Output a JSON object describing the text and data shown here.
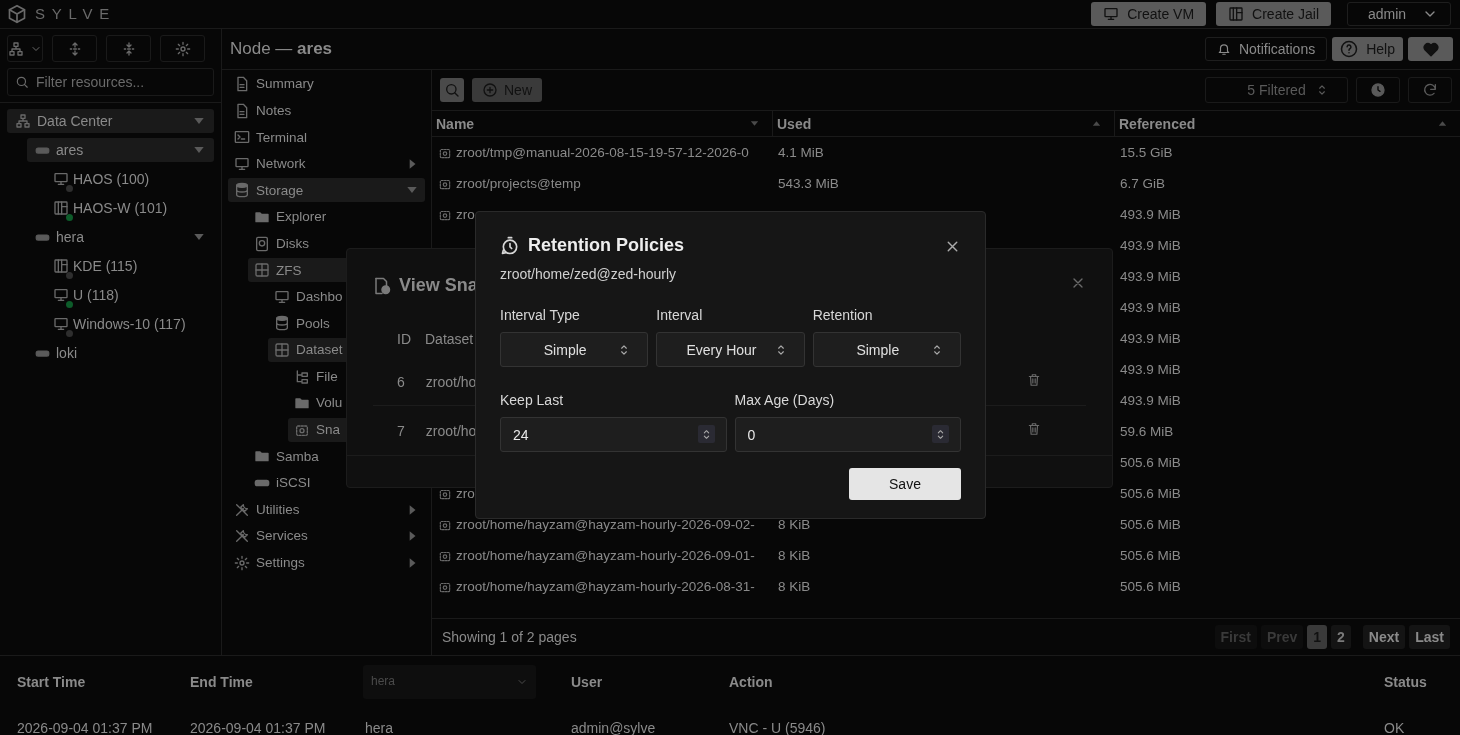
{
  "topbar": {
    "logo": "SYLVE",
    "create_vm": "Create VM",
    "create_jail": "Create Jail",
    "user": "admin"
  },
  "sidebar": {
    "filter_placeholder": "Filter resources...",
    "tree": [
      {
        "label": "Data Center",
        "kind": "datacenter",
        "highlighted": true,
        "expanded": true,
        "children": [
          {
            "label": "ares",
            "kind": "node",
            "highlighted": true,
            "expanded": true,
            "children": [
              {
                "label": "HAOS (100)",
                "kind": "vm",
                "running": false
              },
              {
                "label": "HAOS-W (101)",
                "kind": "jail",
                "running": true
              }
            ]
          },
          {
            "label": "hera",
            "kind": "node",
            "highlighted": false,
            "expanded": true,
            "children": [
              {
                "label": "KDE (115)",
                "kind": "jail",
                "running": false
              },
              {
                "label": "U (118)",
                "kind": "vm",
                "running": true
              },
              {
                "label": "Windows-10 (117)",
                "kind": "vm",
                "running": false
              }
            ]
          },
          {
            "label": "loki",
            "kind": "node",
            "highlighted": false
          }
        ]
      }
    ]
  },
  "header": {
    "title": "Node — **ares**",
    "notifications": "Notifications",
    "help": "Help"
  },
  "nav": [
    {
      "label": "Summary",
      "highlighted": false
    },
    {
      "label": "Notes",
      "highlighted": false
    },
    {
      "label": "Terminal",
      "highlighted": false
    },
    {
      "label": "Network",
      "highlighted": false,
      "expanded": false
    },
    {
      "label": "Storage",
      "highlighted": true,
      "expanded": true,
      "children": [
        {
          "label": "Explorer",
          "highlighted": false
        },
        {
          "label": "Disks",
          "highlighted": false
        },
        {
          "label": "ZFS",
          "highlighted": true,
          "children": [
            {
              "label": "Dashbo",
              "highlighted": false
            },
            {
              "label": "Pools",
              "highlighted": false
            },
            {
              "label": "Dataset",
              "highlighted": true,
              "children": [
                {
                  "label": "File",
                  "highlighted": false
                },
                {
                  "label": "Volu",
                  "highlighted": false
                },
                {
                  "label": "Sna",
                  "highlighted": true
                }
              ]
            }
          ]
        },
        {
          "label": "Samba",
          "highlighted": false
        },
        {
          "label": "iSCSI",
          "highlighted": false
        }
      ]
    },
    {
      "label": "Utilities",
      "highlighted": false,
      "expanded": false
    },
    {
      "label": "Services",
      "highlighted": false,
      "expanded": false
    },
    {
      "label": "Settings",
      "highlighted": false,
      "expanded": false
    }
  ],
  "toolbar": {
    "new": "New",
    "filter": "5 Filtered"
  },
  "table": {
    "columns": [
      {
        "label": "Name"
      },
      {
        "label": "Used"
      },
      {
        "label": "Referenced"
      }
    ],
    "rows": [
      {
        "name": "zroot/tmp@manual-2026-08-15-19-57-12-2026-0",
        "used": "4.1 MiB",
        "referenced": "15.5 GiB"
      },
      {
        "name": "zroot/projects@temp",
        "used": "543.3 MiB",
        "referenced": "6.7 GiB"
      },
      {
        "name": "zro",
        "referenced": "493.9 MiB"
      },
      {
        "referenced": "493.9 MiB"
      },
      {
        "referenced": "493.9 MiB"
      },
      {
        "referenced": "493.9 MiB"
      },
      {
        "referenced": "493.9 MiB"
      },
      {
        "referenced": "493.9 MiB"
      },
      {
        "referenced": "493.9 MiB"
      },
      {
        "referenced": "59.6 MiB"
      },
      {
        "referenced": "505.6 MiB"
      },
      {
        "name": "zro",
        "referenced": "505.6 MiB"
      },
      {
        "name": "zroot/home/hayzam@hayzam-hourly-2026-09-02-",
        "used": "8 KiB",
        "referenced": "505.6 MiB"
      },
      {
        "name": "zroot/home/hayzam@hayzam-hourly-2026-09-01-",
        "used": "8 KiB",
        "referenced": "505.6 MiB"
      },
      {
        "name": "zroot/home/hayzam@hayzam-hourly-2026-08-31-",
        "used": "8 KiB",
        "referenced": "505.6 MiB"
      }
    ],
    "footer": "Showing 1 of 2 pages",
    "pagination": [
      {
        "label": "First",
        "kind": "nav",
        "disabled": true
      },
      {
        "label": "Prev",
        "kind": "nav",
        "disabled": true
      },
      {
        "label": "1",
        "kind": "page",
        "selected": true
      },
      {
        "label": "2",
        "kind": "page",
        "selected": false
      },
      {
        "label": "Next",
        "kind": "nav",
        "disabled": false
      },
      {
        "label": "Last",
        "kind": "nav",
        "disabled": false
      }
    ]
  },
  "audit": {
    "columns": [
      "Start Time",
      "End Time",
      {
        "kind": "select",
        "placeholder": "hera"
      },
      "User",
      "Action",
      "Status"
    ],
    "rows": [
      [
        "2026-09-04 01:37 PM",
        "2026-09-04 01:37 PM",
        "hera",
        "admin@sylve",
        "VNC - U (5946)",
        "OK"
      ]
    ]
  },
  "snapshots_dialog": {
    "title": "View Sna",
    "columns": [
      "ID",
      "Dataset"
    ],
    "rows": [
      {
        "id": "6",
        "dataset": "zroot/ho"
      },
      {
        "id": "7",
        "dataset": "zroot/ho"
      }
    ]
  },
  "retention_dialog": {
    "title": "Retention Policies",
    "subtitle": "zroot/home/zed@zed-hourly",
    "selects": [
      {
        "label": "Interval Type",
        "value": "Simple"
      },
      {
        "label": "Interval",
        "value": "Every Hour"
      },
      {
        "label": "Retention",
        "value": "Simple"
      }
    ],
    "numbers": [
      {
        "label": "Keep Last",
        "value": "24"
      },
      {
        "label": "Max Age (Days)",
        "value": "0"
      }
    ],
    "save": "Save"
  }
}
